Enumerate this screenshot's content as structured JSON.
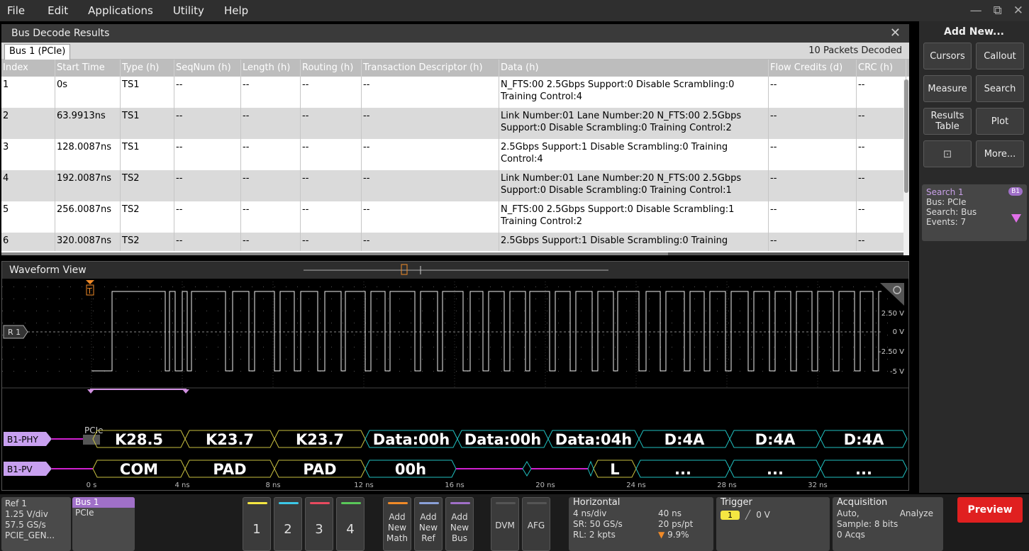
{
  "menu": [
    "File",
    "Edit",
    "Applications",
    "Utility",
    "Help"
  ],
  "window_controls": {
    "minimize": "—",
    "restore": "⧉",
    "close": "✕"
  },
  "decode": {
    "title": "Bus Decode Results",
    "tab": "Bus 1 (PCIe)",
    "packet_count": "10 Packets Decoded",
    "columns": [
      "Index",
      "Start Time",
      "Type (h)",
      "SeqNum (h)",
      "Length (h)",
      "Routing (h)",
      "Transaction Descriptor (h)",
      "Data (h)",
      "Flow Credits (d)",
      "CRC (h)"
    ],
    "rows": [
      [
        "1",
        "0s",
        "TS1",
        "--",
        "--",
        "--",
        "--",
        "N_FTS:00 2.5Gbps Support:0 Disable Scrambling:0 Training Control:4",
        "--",
        "--"
      ],
      [
        "2",
        "63.9913ns",
        "TS1",
        "--",
        "--",
        "--",
        "--",
        "Link Number:01 Lane Number:20 N_FTS:00 2.5Gbps Support:0 Disable Scrambling:0 Training Control:2",
        "--",
        "--"
      ],
      [
        "3",
        "128.0087ns",
        "TS1",
        "--",
        "--",
        "--",
        "--",
        "2.5Gbps Support:1 Disable Scrambling:0 Training Control:4",
        "--",
        "--"
      ],
      [
        "4",
        "192.0087ns",
        "TS2",
        "--",
        "--",
        "--",
        "--",
        "Link Number:01 Lane Number:20 N_FTS:00 2.5Gbps Support:0 Disable Scrambling:0 Training Control:1",
        "--",
        "--"
      ],
      [
        "5",
        "256.0087ns",
        "TS2",
        "--",
        "--",
        "--",
        "--",
        "N_FTS:00 2.5Gbps Support:0 Disable Scrambling:1 Training Control:2",
        "--",
        "--"
      ],
      [
        "6",
        "320.0087ns",
        "TS2",
        "--",
        "--",
        "--",
        "--",
        "2.5Gbps Support:1 Disable Scrambling:0 Training",
        "--",
        "--"
      ]
    ]
  },
  "waveform": {
    "title": "Waveform View",
    "ref_label": "R 1",
    "trigger_marker": "T",
    "volt_labels": [
      "2.50 V",
      "0 V",
      "-2.50 V",
      "-5 V"
    ],
    "time_labels": [
      "0 s",
      "4 ns",
      "8 ns",
      "12 ns",
      "16 ns",
      "20 ns",
      "24 ns",
      "28 ns",
      "32 ns"
    ],
    "bus_phy_label": "B1-PHY",
    "bus_pv_label": "B1-PV",
    "protocol_label": "PCIe",
    "phy_symbols": [
      "K28.5",
      "K23.7",
      "K23.7",
      "Data:00h",
      "Data:00h",
      "Data:04h",
      "D:4A",
      "D:4A",
      "D:4A"
    ],
    "pv_symbols": [
      "COM",
      "PAD",
      "PAD",
      "00h",
      "L",
      "...",
      "...",
      "..."
    ]
  },
  "side": {
    "title": "Add New...",
    "buttons": [
      "Cursors",
      "Callout",
      "Measure",
      "Search",
      "Results Table",
      "Plot",
      "More..."
    ],
    "search_card": {
      "title": "Search 1",
      "badge": "B1",
      "bus": "Bus: PCIe",
      "search": "Search: Bus",
      "events": "Events: 7"
    }
  },
  "bottom": {
    "ref": {
      "title": "Ref 1",
      "scale": "1.25 V/div",
      "rate": "57.5 GS/s",
      "name": "PCIE_GEN..."
    },
    "bus": {
      "title": "Bus 1",
      "type": "PCIe"
    },
    "channels": [
      "1",
      "2",
      "3",
      "4"
    ],
    "add_math": [
      "Add",
      "New",
      "Math"
    ],
    "add_ref": [
      "Add",
      "New",
      "Ref"
    ],
    "add_bus": [
      "Add",
      "New",
      "Bus"
    ],
    "dvm": "DVM",
    "afg": "AFG",
    "horizontal": {
      "title": "Horizontal",
      "scale": "4 ns/div",
      "duration": "40 ns",
      "sr": "SR: 50 GS/s",
      "res": "20 ps/pt",
      "rl": "RL: 2 kpts",
      "pos": "9.9%"
    },
    "trigger": {
      "title": "Trigger",
      "source": "1",
      "level": "0 V"
    },
    "acquisition": {
      "title": "Acquisition",
      "mode": "Auto,",
      "analyze": "Analyze",
      "sample": "Sample: 8 bits",
      "acqs": "0 Acqs"
    },
    "preview": "Preview"
  },
  "colors": {
    "ch1": "#f5e642",
    "ch2": "#3cc8e8",
    "ch3": "#e84a5f",
    "ch4": "#5ac85a",
    "bus": "#a070c8",
    "pv_line": "#d020d0",
    "phy_border": "#c8c040",
    "pv_border": "#20c0c0"
  }
}
